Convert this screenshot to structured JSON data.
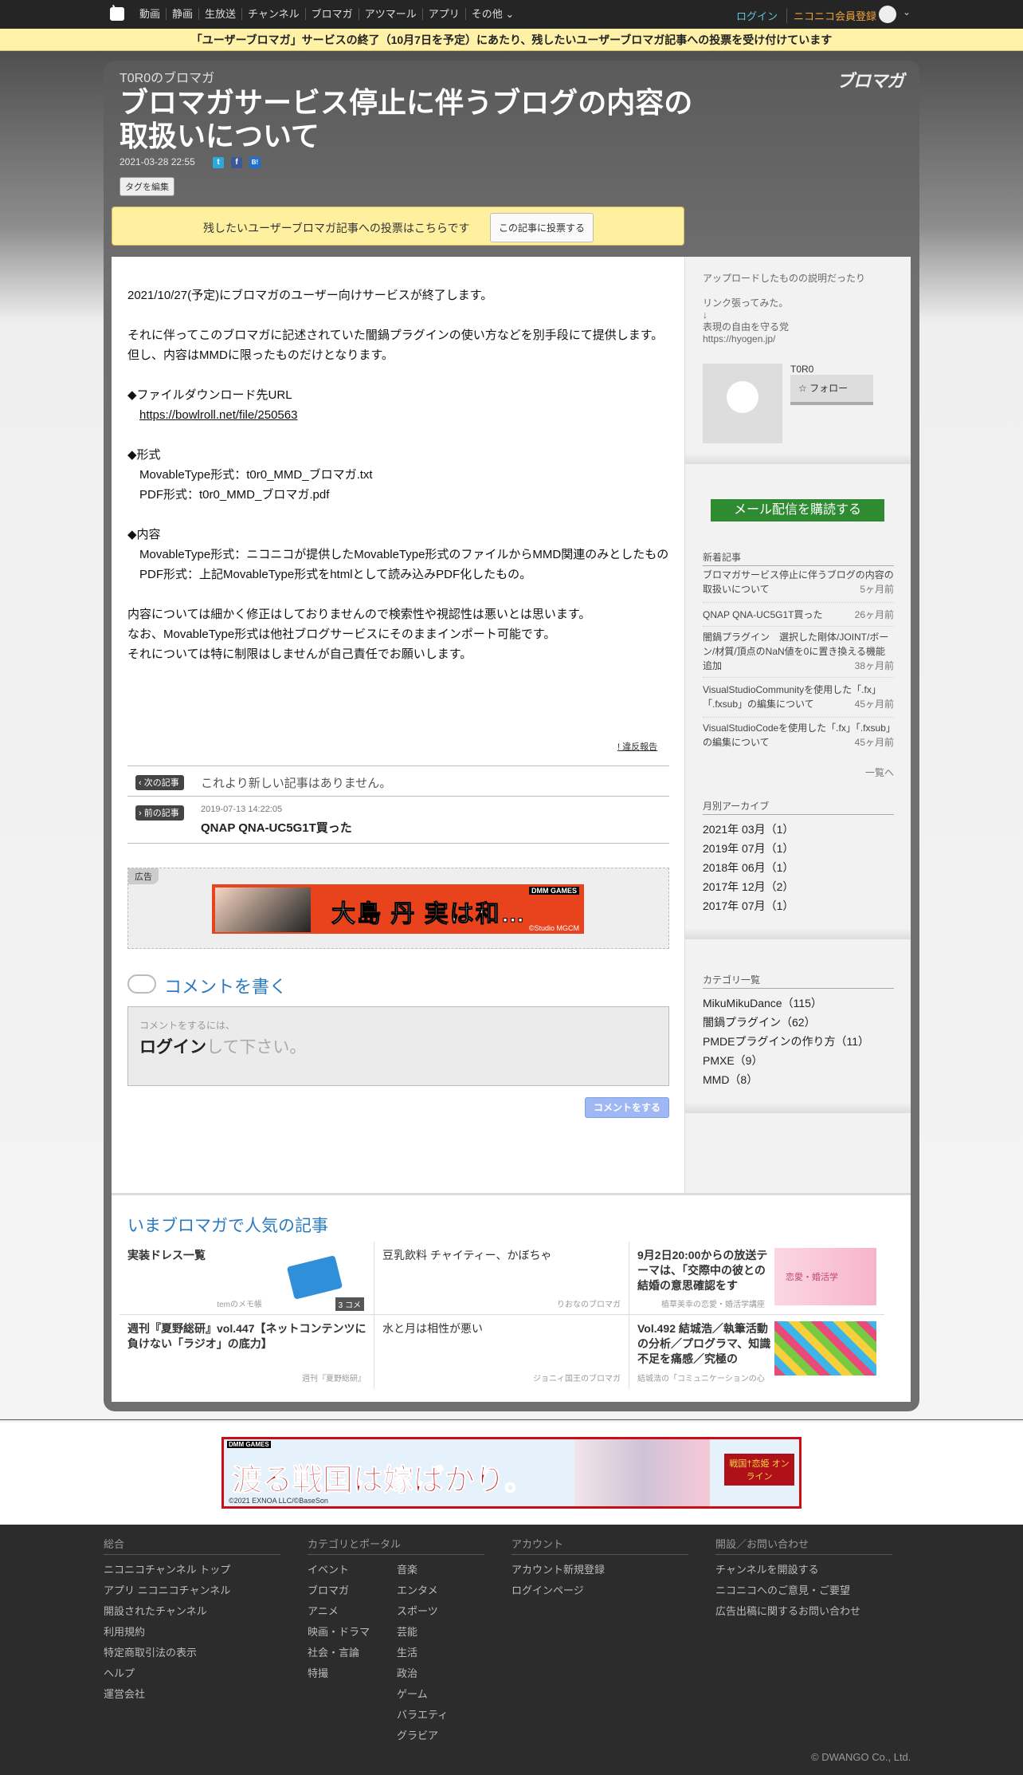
{
  "topnav": {
    "links": [
      "動画",
      "静画",
      "生放送",
      "チャンネル",
      "ブロマガ",
      "アツマール",
      "アプリ",
      "その他"
    ],
    "login": "ログイン",
    "register": "ニコニコ会員登録"
  },
  "notice": "「ユーザーブロマガ」サービスの終了（10月7日を予定）にあたり、残したいユーザーブロマガ記事への投票を受け付けています",
  "header": {
    "channel": "T0R0のブロマガ",
    "brand": "ブロマガ",
    "title": "ブロマガサービス停止に伴うブログの内容の取扱いについて",
    "date": "2021-03-28 22:55",
    "tag_button": "タグを編集"
  },
  "vote": {
    "message": "残したいユーザーブロマガ記事への投票はこちらです",
    "button": "この記事に投票する"
  },
  "article": {
    "p1": "2021/10/27(予定)にブロマガのユーザー向けサービスが終了します。",
    "p2": "それに伴ってこのブロマガに記述されていた闇鍋プラグインの使い方などを別手段にて提供します。但し、内容はMMDに限ったものだけとなります。",
    "dl_head": "◆ファイルダウンロード先URL",
    "dl_url": "https://bowlroll.net/file/250563",
    "fmt_head": "◆形式",
    "fmt_1": "MovableType形式：t0r0_MMD_ブロマガ.txt",
    "fmt_2": "PDF形式：t0r0_MMD_ブロマガ.pdf",
    "content_head": "◆内容",
    "content_1": "MovableType形式：ニコニコが提供したMovableType形式のファイルからMMD関連のみとしたもの",
    "content_2": "PDF形式：上記MovableType形式をhtmlとして読み込みPDF化したもの。",
    "p_last_1": "内容については細かく修正はしておりませんので検索性や視認性は悪いとは思います。",
    "p_last_2": "なお、MovableType形式は他社ブログサービスにそのままインポート可能です。",
    "p_last_3": "それについては特に制限はしませんが自己責任でお願いします。",
    "report": "! 違反報告"
  },
  "article_nav": {
    "next_label": "次の記事",
    "next_text": "これより新しい記事はありません。",
    "prev_label": "前の記事",
    "prev_date": "2019-07-13 14:22:05",
    "prev_title": "QNAP QNA-UC5G1T買った"
  },
  "ad": {
    "label": "広告",
    "banner_text": "大島 丹 実は和…",
    "banner_brand": "DMM GAMES",
    "banner_credit": "©Studio MGCM"
  },
  "comment": {
    "heading": "コメントを書く",
    "hint": "コメントをするには、",
    "login": "ログイン",
    "login_suffix": "して下さい。",
    "button": "コメントをする"
  },
  "popular": {
    "heading": "いまブロマガで人気の記事",
    "items": [
      {
        "title": "実装ドレス一覧",
        "source": "temのメモ帳",
        "badge": "3 コメ"
      },
      {
        "title": "豆乳飲料 チャイティー、かぼちゃ",
        "source": "りおなのブロマガ"
      },
      {
        "title": "9月2日20:00からの放送テーマは、「交際中の彼との結婚の意思確認をす",
        "source": "植草美幸の恋愛・婚活学講座",
        "thumb": "恋愛・婚活学"
      },
      {
        "title": "週刊『夏野総研』vol.447【ネットコンテンツに負けない「ラジオ」の底力】",
        "source": "週刊『夏野総研』"
      },
      {
        "title": "水と月は相性が悪い",
        "source": "ジョニィ国王のブロマガ"
      },
      {
        "title": "Vol.492 結城浩／執筆活動の分析／プログラマ、知識不足を痛感／究極の",
        "source": "結城浩の「コミュニケーションの心"
      }
    ]
  },
  "sidebar": {
    "desc_1": "アップロードしたものの説明だったり",
    "desc_2": "リンク張ってみた。",
    "desc_3": "↓",
    "desc_4": "表現の自由を守る党",
    "desc_5": "https://hyogen.jp/",
    "author": "T0R0",
    "follow": "フォロー",
    "mail_button": "メール配信を購読する",
    "recent_title": "新着記事",
    "recent": [
      {
        "title": "ブロマガサービス停止に伴うブログの内容の取扱いについて",
        "ago": "5ヶ月前"
      },
      {
        "title": "QNAP QNA-UC5G1T買った",
        "ago": "26ヶ月前"
      },
      {
        "title": "闇鍋プラグイン　選択した剛体/JOINT/ボーン/材質/頂点のNaN値を0に置き換える機能追加",
        "ago": "38ヶ月前"
      },
      {
        "title": "VisualStudioCommunityを使用した「.fx」「.fxsub」の編集について",
        "ago": "45ヶ月前"
      },
      {
        "title": "VisualStudioCodeを使用した「.fx」「.fxsub」の編集について",
        "ago": "45ヶ月前"
      }
    ],
    "more": "一覧へ",
    "archive_title": "月別アーカイブ",
    "archive": [
      "2021年 03月（1）",
      "2019年 07月（1）",
      "2018年 06月（1）",
      "2017年 12月（2）",
      "2017年 07月（1）"
    ],
    "category_title": "カテゴリ一覧",
    "categories": [
      "MikuMikuDance（115）",
      "闇鍋プラグイン（62）",
      "PMDEプラグインの作り方（11）",
      "PMXE（9）",
      "MMD（8）"
    ]
  },
  "footer_ad": {
    "text": "渡る戦国は嫁ばかり。",
    "brand": "DMM GAMES",
    "badge": "戦国†恋姫 オンライン",
    "credit": "©2021 EXNOA LLC/©BaseSon"
  },
  "footer": {
    "col1_title": "総合",
    "col1": [
      "ニコニコチャンネル トップ",
      "アプリ ニコニコチャンネル",
      "開設されたチャンネル",
      "利用規約",
      "特定商取引法の表示",
      "ヘルプ",
      "運営会社"
    ],
    "col2_title": "カテゴリとポータル",
    "col2a": [
      "イベント",
      "ブロマガ",
      "アニメ",
      "映画・ドラマ",
      "社会・言論",
      "特撮"
    ],
    "col2b": [
      "音楽",
      "エンタメ",
      "スポーツ",
      "芸能",
      "生活",
      "政治",
      "ゲーム",
      "バラエティ",
      "グラビア"
    ],
    "col3_title": "アカウント",
    "col3": [
      "アカウント新規登録",
      "ログインページ"
    ],
    "col4_title": "開設／お問い合わせ",
    "col4": [
      "チャンネルを開設する",
      "ニコニコへのご意見・ご要望",
      "広告出稿に関するお問い合わせ"
    ],
    "copyright": "© DWANGO Co., Ltd."
  }
}
